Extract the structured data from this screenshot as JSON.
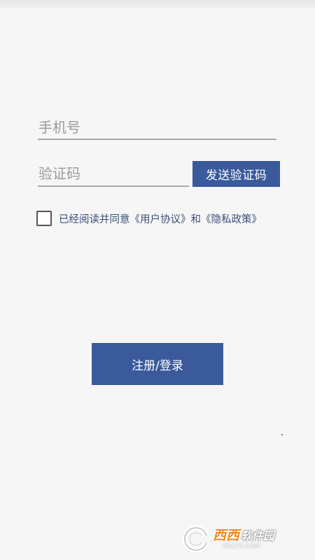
{
  "form": {
    "phone_placeholder": "手机号",
    "code_placeholder": "验证码",
    "send_code_label": "发送验证码",
    "agreement_text": "已经阅读并同意《用户协议》和《隐私政策》",
    "agreement_checked": false,
    "submit_label": "注册/登录"
  },
  "watermark": {
    "brand_a": "西西",
    "brand_b": "软件园",
    "url": "CR173.COM"
  },
  "colors": {
    "primary": "#3a5a9c",
    "background": "#f6f6f6",
    "watermark_accent": "#f28a1c"
  }
}
